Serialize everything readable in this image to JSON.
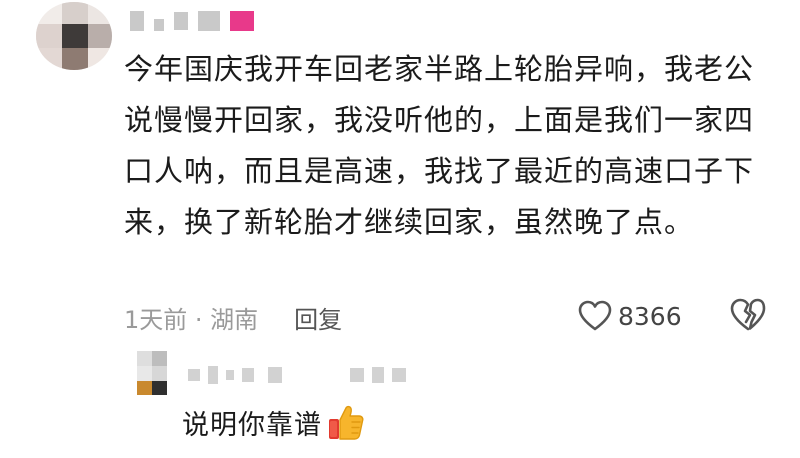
{
  "comment": {
    "text": "今年国庆我开车回老家半路上轮胎异响，我老公说慢慢开回家，我没听他的，上面是我们一家四口人呐，而且是高速，我找了最近的高速口子下来，换了新轮胎才继续回家，虽然晚了点。",
    "time_location": "1天前 · 湖南",
    "reply_label": "回复",
    "like_count": "8366"
  },
  "reply": {
    "text": "说明你靠谱"
  },
  "icons": {
    "like": "heart-outline-icon",
    "dislike": "broken-heart-icon",
    "emoji": "thumbs-up-emoji-icon"
  },
  "colors": {
    "text": "#1b1b1b",
    "meta": "#9a9a9a",
    "accent_pink": "#e8398a"
  }
}
